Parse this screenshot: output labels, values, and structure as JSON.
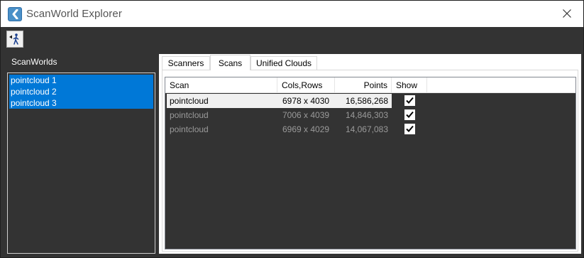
{
  "window": {
    "title": "ScanWorld Explorer"
  },
  "icons": {
    "app": "app-icon",
    "close": "close-icon",
    "toolbar_tool": "walker-icon",
    "checkmark": "checkmark-icon"
  },
  "colors": {
    "selection": "#0078d7",
    "panel_bg": "#333333",
    "title_bg": "#ffffff",
    "dim_text": "#9a9a9a"
  },
  "left_panel": {
    "label": "ScanWorlds",
    "items": [
      {
        "label": "pointcloud 1",
        "selected": true
      },
      {
        "label": "pointcloud 2",
        "selected": true
      },
      {
        "label": "pointcloud 3",
        "selected": true
      }
    ]
  },
  "tabs": [
    {
      "label": "Scanners",
      "active": false
    },
    {
      "label": "Scans",
      "active": true
    },
    {
      "label": "Unified Clouds",
      "active": false
    }
  ],
  "scans_table": {
    "columns": [
      "Scan",
      "Cols,Rows",
      "Points",
      "Show"
    ],
    "rows": [
      {
        "scan": "pointcloud",
        "cols_rows": "6978 x 4030",
        "points": "16,586,268",
        "show": true,
        "selected": true
      },
      {
        "scan": "pointcloud",
        "cols_rows": "7006 x 4039",
        "points": "14,846,303",
        "show": true,
        "selected": false
      },
      {
        "scan": "pointcloud",
        "cols_rows": "6969 x 4029",
        "points": "14,067,083",
        "show": true,
        "selected": false
      }
    ]
  }
}
